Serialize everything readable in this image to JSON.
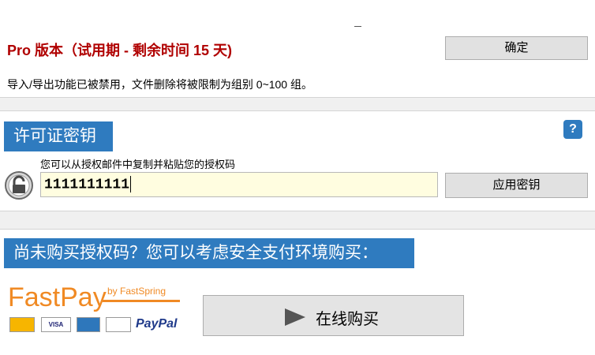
{
  "edition": {
    "title": "Pro 版本（试用期 - 剩余时间 15 天)",
    "ok_label": "确定",
    "notice": "导入/导出功能已被禁用，文件删除将被限制为组别 0~100 组。"
  },
  "license": {
    "banner": "许可证密钥",
    "help": "?",
    "hint": "您可以从授权邮件中复制并粘贴您的授权码",
    "key_value": "1111111111",
    "apply_label": "应用密钥"
  },
  "purchase": {
    "banner": "尚未购买授权码？您可以考虑安全支付环境购买：",
    "fastpay": "FastPay",
    "by": "by FastSpring",
    "cards": [
      "MasterCard",
      "VISA",
      "AMEX",
      "DISCOVER"
    ],
    "paypal": "PayPal",
    "buy_label": "在线购买"
  },
  "colors": {
    "accent": "#2f7bbf",
    "title_red": "#b00000",
    "fastpay_orange": "#f08a24"
  }
}
